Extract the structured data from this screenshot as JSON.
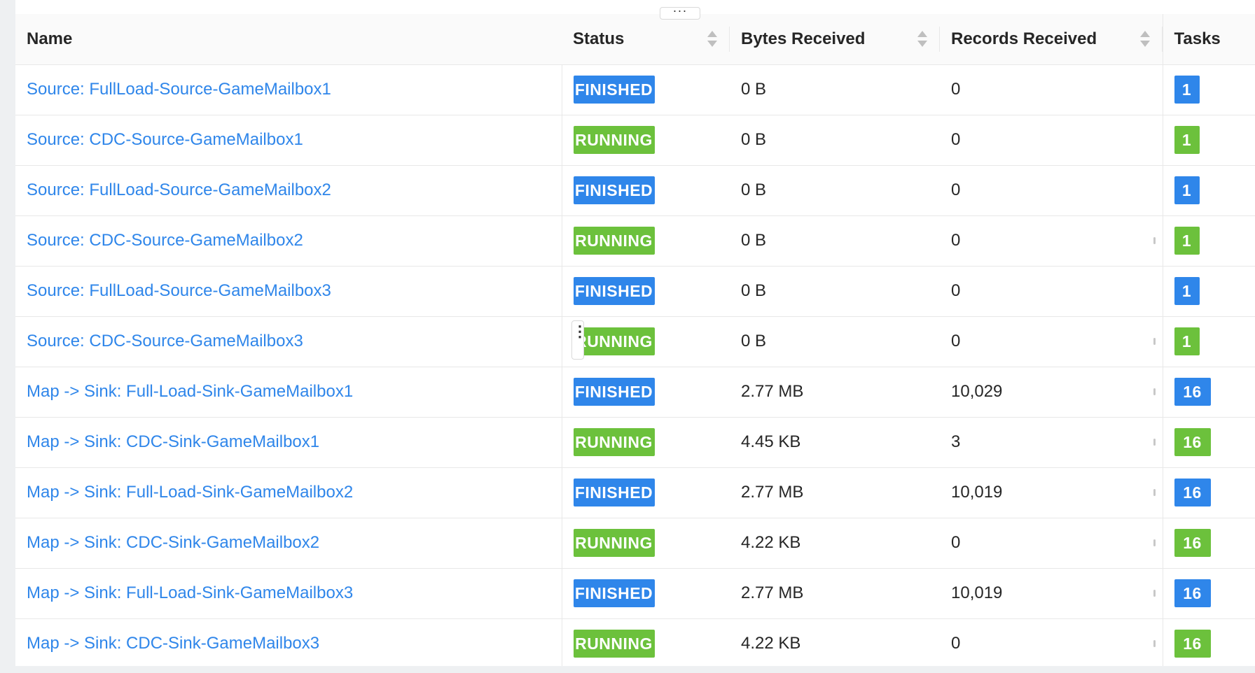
{
  "ui": {
    "collapse_glyph": "···",
    "row_handle_glyph": "⋮"
  },
  "colors": {
    "finished": "#2f86ea",
    "running": "#6cc13c",
    "link": "#2f86ea"
  },
  "columns": {
    "name": "Name",
    "status": "Status",
    "bytes_received": "Bytes Received",
    "records_received": "Records Received",
    "tasks": "Tasks"
  },
  "rows": [
    {
      "name": "Source: FullLoad-Source-GameMailbox1",
      "status": "FINISHED",
      "bytes": "0 B",
      "records": "0",
      "tasks": "1"
    },
    {
      "name": "Source: CDC-Source-GameMailbox1",
      "status": "RUNNING",
      "bytes": "0 B",
      "records": "0",
      "tasks": "1"
    },
    {
      "name": "Source: FullLoad-Source-GameMailbox2",
      "status": "FINISHED",
      "bytes": "0 B",
      "records": "0",
      "tasks": "1"
    },
    {
      "name": "Source: CDC-Source-GameMailbox2",
      "status": "RUNNING",
      "bytes": "0 B",
      "records": "0",
      "tasks": "1"
    },
    {
      "name": "Source: FullLoad-Source-GameMailbox3",
      "status": "FINISHED",
      "bytes": "0 B",
      "records": "0",
      "tasks": "1"
    },
    {
      "name": "Source: CDC-Source-GameMailbox3",
      "status": "RUNNING",
      "bytes": "0 B",
      "records": "0",
      "tasks": "1"
    },
    {
      "name": "Map -> Sink: Full-Load-Sink-GameMailbox1",
      "status": "FINISHED",
      "bytes": "2.77 MB",
      "records": "10,029",
      "tasks": "16"
    },
    {
      "name": "Map -> Sink: CDC-Sink-GameMailbox1",
      "status": "RUNNING",
      "bytes": "4.45 KB",
      "records": "3",
      "tasks": "16"
    },
    {
      "name": "Map -> Sink: Full-Load-Sink-GameMailbox2",
      "status": "FINISHED",
      "bytes": "2.77 MB",
      "records": "10,019",
      "tasks": "16"
    },
    {
      "name": "Map -> Sink: CDC-Sink-GameMailbox2",
      "status": "RUNNING",
      "bytes": "4.22 KB",
      "records": "0",
      "tasks": "16"
    },
    {
      "name": "Map -> Sink: Full-Load-Sink-GameMailbox3",
      "status": "FINISHED",
      "bytes": "2.77 MB",
      "records": "10,019",
      "tasks": "16"
    },
    {
      "name": "Map -> Sink: CDC-Sink-GameMailbox3",
      "status": "RUNNING",
      "bytes": "4.22 KB",
      "records": "0",
      "tasks": "16"
    }
  ]
}
